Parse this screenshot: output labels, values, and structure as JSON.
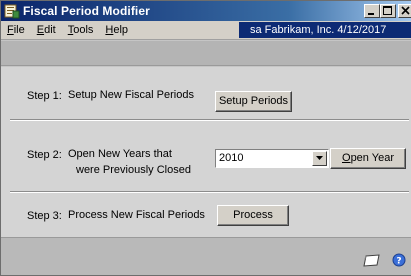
{
  "window": {
    "title": "Fiscal Period Modifier"
  },
  "menu": {
    "items": [
      {
        "label_underlined": "F",
        "label_rest": "ile"
      },
      {
        "label_underlined": "E",
        "label_rest": "dit"
      },
      {
        "label_underlined": "T",
        "label_rest": "ools"
      },
      {
        "label_underlined": "H",
        "label_rest": "elp"
      }
    ],
    "info": "sa  Fabrikam, Inc.  4/12/2017"
  },
  "steps": {
    "step1": {
      "label": "Step 1:",
      "desc": "Setup New Fiscal Periods",
      "button": "Setup Periods"
    },
    "step2": {
      "label": "Step 2:",
      "desc_line1": "Open New Years that",
      "desc_line2": "were Previously Closed",
      "year_value": "2010",
      "button_underlined": "O",
      "button_rest": "pen Year"
    },
    "step3": {
      "label": "Step 3:",
      "desc": "Process New Fiscal Periods",
      "button": "Process"
    }
  },
  "icons": {
    "app": "app-icon",
    "minimize": "minimize-icon",
    "maximize": "maximize-icon",
    "close": "close-icon",
    "dropdown": "chevron-down-icon",
    "note": "note-icon",
    "help": "help-icon"
  }
}
